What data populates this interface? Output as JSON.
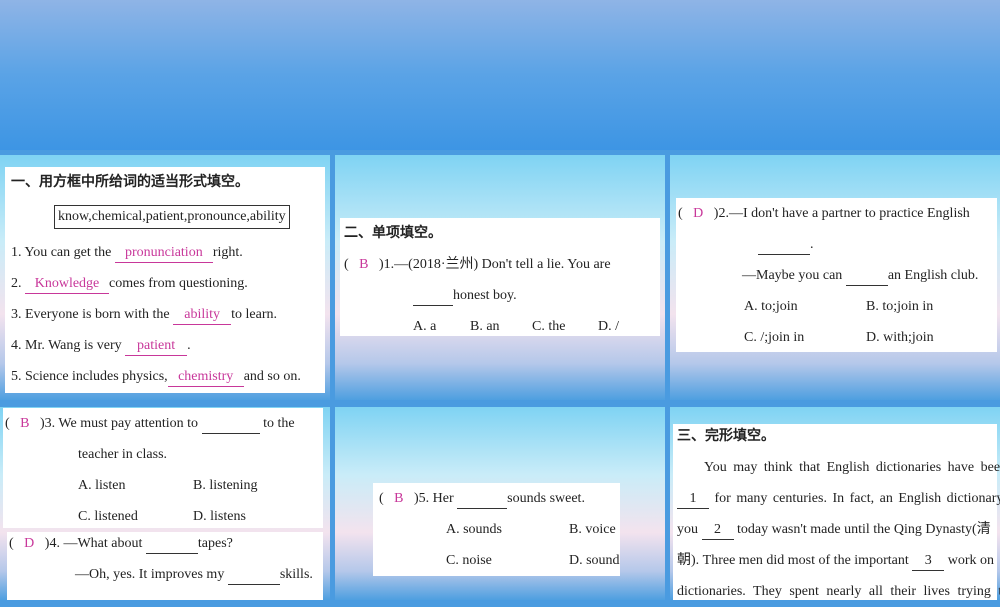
{
  "section1": {
    "title": "一、用方框中所给词的适当形式填空。",
    "word_box": "know,chemical,patient,pronounce,ability",
    "items": [
      {
        "pre": "1. You can get the",
        "answer": "pronunciation",
        "post": "right."
      },
      {
        "pre": "2.",
        "answer": "Knowledge",
        "post": "comes from questioning."
      },
      {
        "pre": "3. Everyone is born with the",
        "answer": "ability",
        "post": "to learn."
      },
      {
        "pre": "4. Mr. Wang is very",
        "answer": "patient",
        "post": "."
      },
      {
        "pre": "5. Science includes physics,",
        "answer": "chemistry",
        "post": "and so on."
      }
    ]
  },
  "section2": {
    "title": "二、单项填空。",
    "q1": {
      "answer": "B",
      "text1": ")1.—(2018·兰州) Don't tell a lie. You are",
      "text2": "honest boy.",
      "options": [
        "A. a",
        "B. an",
        "C. the",
        "D. /"
      ]
    },
    "q2": {
      "answer": "D",
      "text1": ")2.—I don't have a partner to practice English",
      "text2": ".",
      "text3": "—Maybe you can",
      "text4": "an English club.",
      "options": [
        "A. to;join",
        "B. to;join in",
        "C. /;join in",
        "D. with;join"
      ]
    },
    "q3": {
      "answer": "B",
      "text1": ")3. We must pay attention to",
      "text2": "to the",
      "text3": "teacher in class.",
      "options": [
        "A. listen",
        "B. listening",
        "C. listened",
        "D. listens"
      ]
    },
    "q4": {
      "answer": "D",
      "text1": ")4. —What about",
      "text2": "tapes?",
      "text3": "—Oh, yes. It improves my",
      "text4": "skills."
    },
    "q5": {
      "answer": "B",
      "text1": ")5. Her",
      "text2": "sounds sweet.",
      "options": [
        "A. sounds",
        "B. voice",
        "C. noise",
        "D. sound"
      ]
    }
  },
  "section3": {
    "title": "三、完形填空。",
    "lines": [
      {
        "pre": "You may think that English dictionaries have been"
      },
      {
        "blank": "1",
        "post": "for many centuries. In fact, an English dictionary"
      },
      {
        "pre": "you",
        "blank": "2",
        "post": "today wasn't made until the Qing Dynasty(清"
      },
      {
        "pre": "朝). Three men did most of the important",
        "blank": "3",
        "post": "work on"
      },
      {
        "pre": "dictionaries. They spent nearly all their lives trying to"
      }
    ]
  }
}
